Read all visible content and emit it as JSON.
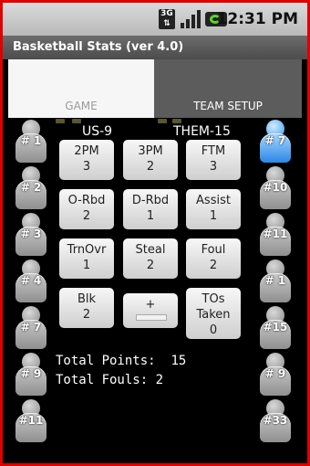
{
  "status_bar": {
    "network": "3G",
    "time": "12:31 PM"
  },
  "title": "Basketball Stats (ver 4.0)",
  "tabs": [
    {
      "label": "GAME"
    },
    {
      "label": "TEAM SETUP"
    }
  ],
  "score": {
    "us": "US-9",
    "them": "THEM-15"
  },
  "stats": [
    {
      "lines": [
        "2PM",
        "3"
      ]
    },
    {
      "lines": [
        "3PM",
        "2"
      ]
    },
    {
      "lines": [
        "FTM",
        "3"
      ]
    },
    {
      "lines": [
        "O-Rbd",
        "2"
      ]
    },
    {
      "lines": [
        "D-Rbd",
        "1"
      ]
    },
    {
      "lines": [
        "Assist",
        "1"
      ]
    },
    {
      "lines": [
        "TrnOvr",
        "1"
      ]
    },
    {
      "lines": [
        "Steal",
        "2"
      ]
    },
    {
      "lines": [
        "Foul",
        "2"
      ]
    },
    {
      "lines": [
        "Blk",
        "2"
      ]
    },
    {
      "lines": [
        "+"
      ]
    },
    {
      "lines": [
        "TOs",
        "Taken",
        "0"
      ]
    }
  ],
  "totals": {
    "points_label": "Total Points:",
    "points_value": "15",
    "fouls_label": "Total Fouls:",
    "fouls_value": "2"
  },
  "left_players": [
    {
      "num": "# 1"
    },
    {
      "num": "# 2"
    },
    {
      "num": "# 3"
    },
    {
      "num": "# 4"
    },
    {
      "num": "# 7"
    },
    {
      "num": "# 9"
    },
    {
      "num": "#11"
    }
  ],
  "right_players": [
    {
      "num": "# 7",
      "selected": true
    },
    {
      "num": "#10"
    },
    {
      "num": "#11"
    },
    {
      "num": "# 1"
    },
    {
      "num": "#15"
    },
    {
      "num": "# 9"
    },
    {
      "num": "#33"
    }
  ]
}
